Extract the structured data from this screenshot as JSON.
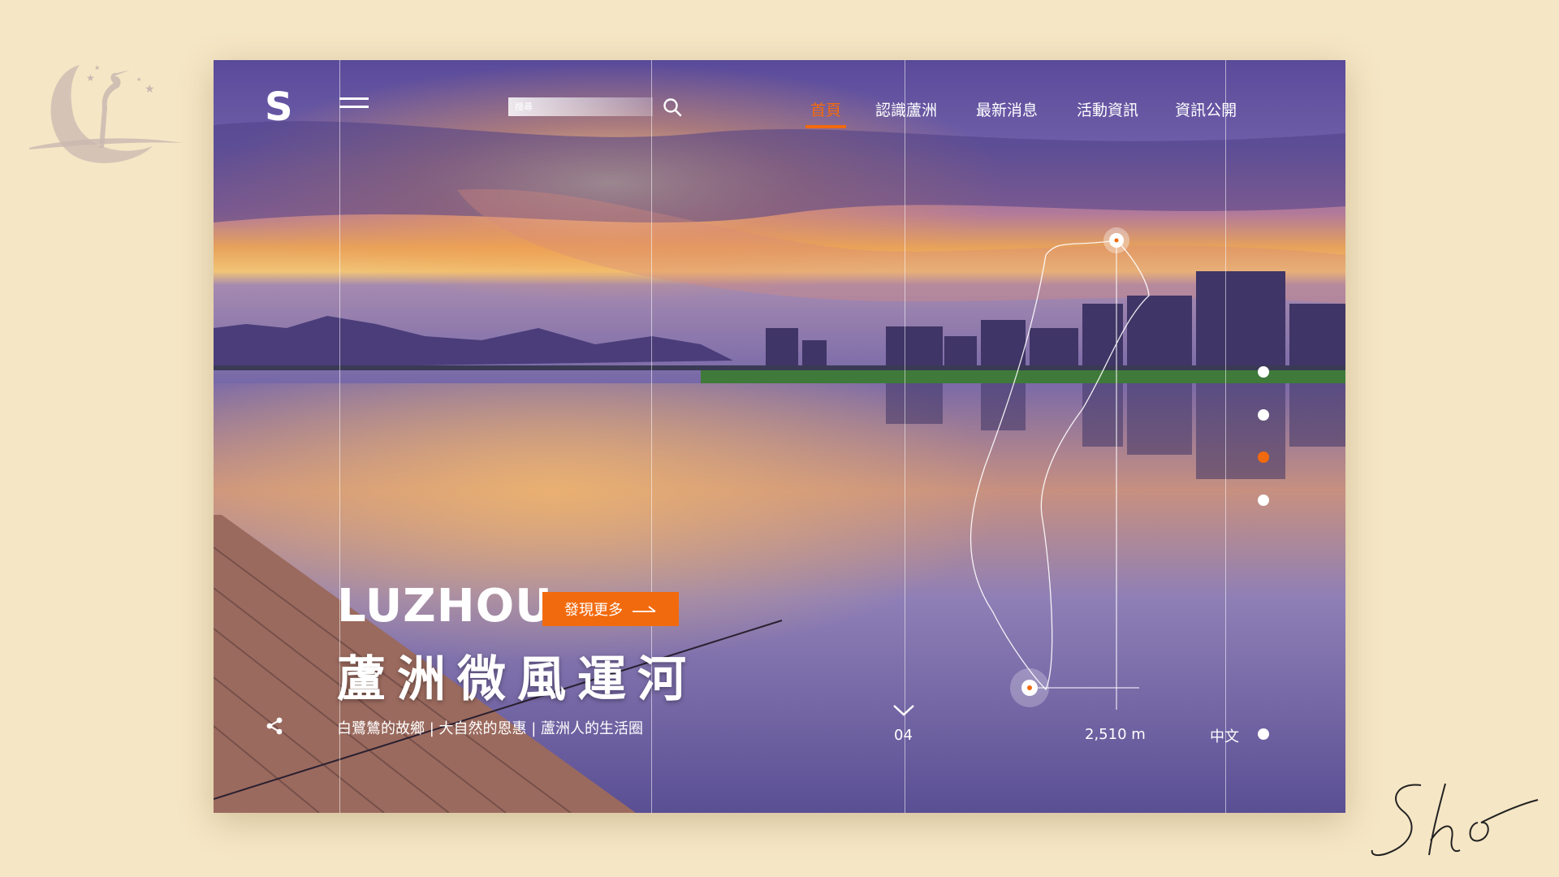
{
  "brand": {
    "logo_letter": "S"
  },
  "search": {
    "placeholder": "搜尋"
  },
  "nav": {
    "items": [
      {
        "label": "首頁",
        "active": true
      },
      {
        "label": "認識蘆洲",
        "active": false
      },
      {
        "label": "最新消息",
        "active": false
      },
      {
        "label": "活動資訊",
        "active": false
      },
      {
        "label": "資訊公開",
        "active": false
      }
    ]
  },
  "hero": {
    "title": "LUZHOU",
    "cta_label": "發現更多",
    "chinese_title": "蘆洲微風運河",
    "tagline": "白鷺鷥的故鄉 | 大自然的恩惠 | 蘆洲人的生活圈"
  },
  "footer": {
    "page_number": "04",
    "distance": "2,510 m",
    "language": "中文"
  },
  "pager": {
    "count": 4,
    "active_index": 2
  },
  "colors": {
    "accent": "#f26a0e",
    "background": "#f5e6c5",
    "sky_purple": "#6e5ea8"
  },
  "icons": [
    "heron-moon-logo-icon",
    "menu-icon",
    "search-icon",
    "arrow-right-icon",
    "share-icon",
    "chevron-down-icon",
    "signature-icon"
  ]
}
